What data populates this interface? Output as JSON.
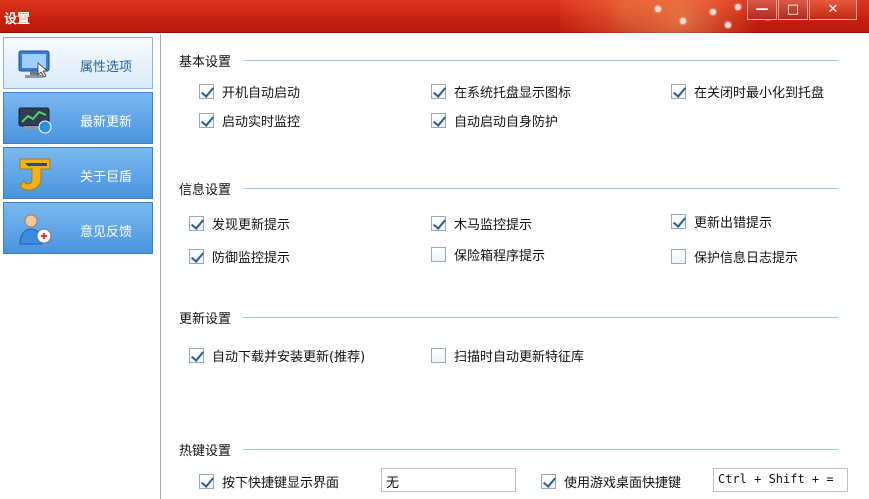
{
  "window": {
    "title": "设置",
    "controls": {
      "minimize": "—",
      "maximize": "□",
      "close": "✕"
    }
  },
  "sidebar": {
    "items": [
      {
        "label": "属性选项",
        "icon": "monitor-icon"
      },
      {
        "label": "最新更新",
        "icon": "update-icon"
      },
      {
        "label": "关于巨盾",
        "icon": "shield-logo-icon"
      },
      {
        "label": "意见反馈",
        "icon": "user-feedback-icon"
      }
    ]
  },
  "sections": {
    "basic": {
      "title": "基本设置",
      "options": [
        {
          "label": "开机自动启动",
          "checked": true
        },
        {
          "label": "在系统托盘显示图标",
          "checked": true
        },
        {
          "label": "在关闭时最小化到托盘",
          "checked": true
        },
        {
          "label": "启动实时监控",
          "checked": true
        },
        {
          "label": "自动启动自身防护",
          "checked": true
        }
      ]
    },
    "info": {
      "title": "信息设置",
      "options": [
        {
          "label": "发现更新提示",
          "checked": true
        },
        {
          "label": "木马监控提示",
          "checked": true
        },
        {
          "label": "更新出错提示",
          "checked": true
        },
        {
          "label": "防御监控提示",
          "checked": true
        },
        {
          "label": "保险箱程序提示",
          "checked": false
        },
        {
          "label": "保护信息日志提示",
          "checked": false
        }
      ]
    },
    "update": {
      "title": "更新设置",
      "options": [
        {
          "label": "自动下载并安装更新(推荐)",
          "checked": true
        },
        {
          "label": "扫描时自动更新特征库",
          "checked": false
        }
      ]
    },
    "hotkey": {
      "title": "热键设置",
      "options": [
        {
          "label": "按下快捷键显示界面",
          "checked": true,
          "value": "无"
        },
        {
          "label": "使用游戏桌面快捷键",
          "checked": true,
          "value": "Ctrl + Shift + ="
        }
      ]
    }
  }
}
